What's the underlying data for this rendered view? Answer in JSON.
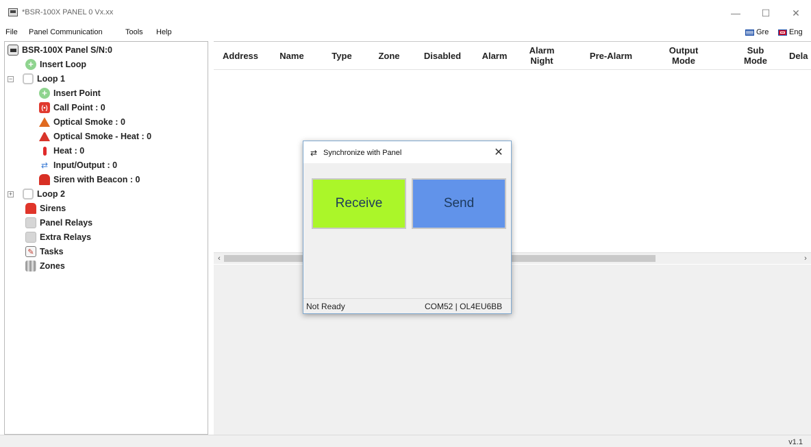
{
  "window": {
    "title": "*BSR-100X PANEL 0 Vx.xx",
    "minimize_glyph": "—",
    "maximize_glyph": "☐",
    "close_glyph": "✕"
  },
  "menu": {
    "items": [
      "File",
      "Panel Communication",
      "Tools",
      "Help"
    ],
    "lang_greek": "Gre",
    "lang_english": "Eng"
  },
  "tree": {
    "root": "BSR-100X Panel S/N:0",
    "insert_loop": "Insert Loop",
    "loop1": "Loop 1",
    "insert_point": "Insert Point",
    "call_point": "Call Point : 0",
    "optical_smoke": "Optical Smoke : 0",
    "optical_smoke_heat": "Optical Smoke - Heat : 0",
    "heat": "Heat : 0",
    "input_output": "Input/Output : 0",
    "siren_beacon": "Siren with Beacon : 0",
    "loop2": "Loop 2",
    "sirens": "Sirens",
    "panel_relays": "Panel Relays",
    "extra_relays": "Extra Relays",
    "tasks": "Tasks",
    "zones": "Zones"
  },
  "table": {
    "columns": [
      "Address",
      "Name",
      "Type",
      "Zone",
      "Disabled",
      "Alarm",
      "Alarm Night",
      "Pre-Alarm",
      "Output Mode",
      "Sub Mode",
      "Dela"
    ]
  },
  "dialog": {
    "title": "Synchronize with Panel",
    "close_glyph": "✕",
    "receive_label": "Receive",
    "send_label": "Send",
    "status_left": "Not Ready",
    "status_right": "COM52 | OL4EU6BB",
    "colors": {
      "receive": "#abf629",
      "send": "#6193ea"
    }
  },
  "statusbar": {
    "version": "v1.1"
  }
}
